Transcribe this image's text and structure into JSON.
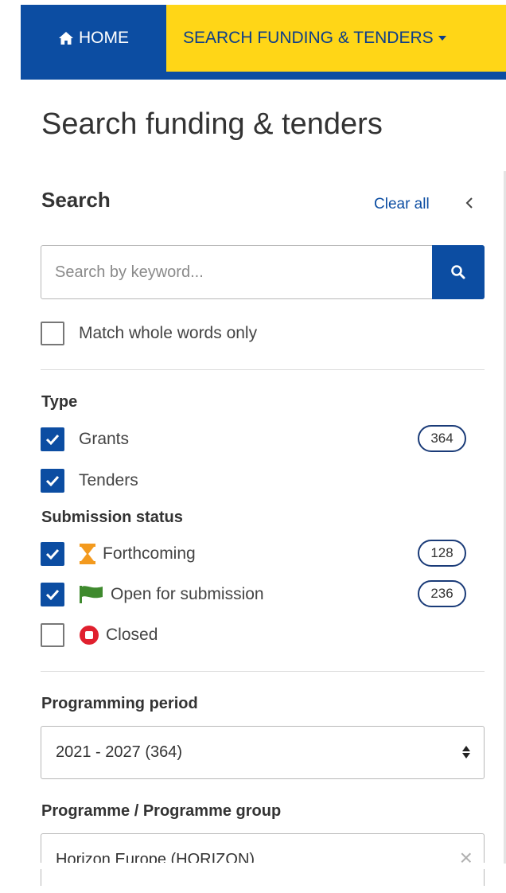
{
  "nav": {
    "home_label": "HOME",
    "search_label": "SEARCH FUNDING & TENDERS",
    "colors": {
      "blue": "#0c4da2",
      "yellow": "#ffd617"
    }
  },
  "page_title": "Search funding & tenders",
  "search": {
    "heading": "Search",
    "clear_all": "Clear all",
    "collapse_icon": "chevron-left-icon",
    "placeholder": "Search by keyword...",
    "button_icon": "search-icon",
    "match_whole_words": {
      "label": "Match whole words only",
      "checked": false
    }
  },
  "type": {
    "label": "Type",
    "items": [
      {
        "label": "Grants",
        "checked": true,
        "count": "364"
      },
      {
        "label": "Tenders",
        "checked": true,
        "count": ""
      }
    ]
  },
  "submission_status": {
    "label": "Submission status",
    "items": [
      {
        "label": "Forthcoming",
        "checked": true,
        "icon": "hourglass-icon",
        "count": "128"
      },
      {
        "label": "Open for submission",
        "checked": true,
        "icon": "flag-icon",
        "count": "236"
      },
      {
        "label": "Closed",
        "checked": false,
        "icon": "stop-icon",
        "count": ""
      }
    ]
  },
  "programming_period": {
    "label": "Programming period",
    "selected": "2021 - 2027 (364)"
  },
  "programme": {
    "label": "Programme / Programme group",
    "selected": "Horizon Europe (HORIZON)",
    "clear_symbol": "×"
  }
}
